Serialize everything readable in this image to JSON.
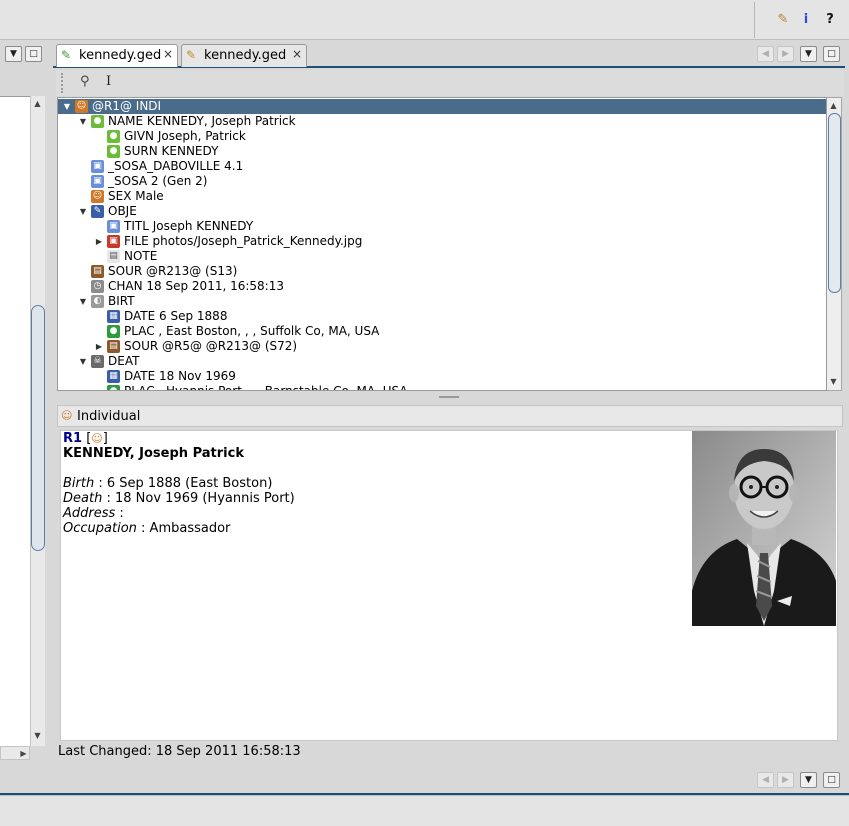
{
  "colors": {
    "accent": "#1f4e79",
    "selection": "#4b6b8a",
    "link_id": "#00008b"
  },
  "top_toolbar": {
    "icons": [
      "hint-icon",
      "info-icon",
      "context-help-icon"
    ]
  },
  "tabs": [
    {
      "label": "kennedy.ged",
      "icon": "pencil-edit-icon",
      "close": "×",
      "active": true
    },
    {
      "label": "kennedy.ged",
      "icon": "tree-view-icon",
      "close": "×",
      "active": false
    }
  ],
  "editor_toolbar": {
    "icons": [
      "link-icon",
      "text-cursor-icon"
    ],
    "cursor_glyph": "I"
  },
  "tree": {
    "rows": [
      {
        "label": "@R1@ INDI",
        "toggle": "▼",
        "icon": "person-icon",
        "selected": true
      },
      {
        "label": "NAME KENNEDY, Joseph Patrick",
        "toggle": "▼",
        "icon": "name-bubble-icon"
      },
      {
        "label": "GIVN Joseph, Patrick",
        "toggle": "",
        "icon": "name-bubble-icon"
      },
      {
        "label": "SURN KENNEDY",
        "toggle": "",
        "icon": "name-bubble-icon"
      },
      {
        "label": "_SOSA_DABOVILLE 4.1",
        "toggle": "",
        "icon": "tag-icon"
      },
      {
        "label": "_SOSA 2 (Gen 2)",
        "toggle": "",
        "icon": "tag-icon"
      },
      {
        "label": "SEX Male",
        "toggle": "",
        "icon": "person-icon"
      },
      {
        "label": "OBJE",
        "toggle": "▼",
        "icon": "media-icon"
      },
      {
        "label": "TITL Joseph KENNEDY",
        "toggle": "",
        "icon": "tag-icon"
      },
      {
        "label": "FILE photos/Joseph_Patrick_Kennedy.jpg",
        "toggle": "▶",
        "icon": "image-file-icon"
      },
      {
        "label": "NOTE",
        "toggle": "",
        "icon": "note-icon"
      },
      {
        "label": "SOUR @R213@ (S13)",
        "toggle": "",
        "icon": "source-icon"
      },
      {
        "label": "CHAN 18 Sep 2011, 16:58:13",
        "toggle": "",
        "icon": "clock-icon"
      },
      {
        "label": "BIRT",
        "toggle": "▼",
        "icon": "birth-icon"
      },
      {
        "label": "DATE 6 Sep 1888",
        "toggle": "",
        "icon": "date-icon"
      },
      {
        "label": "PLAC , East Boston, , , Suffolk Co, MA, USA",
        "toggle": "",
        "icon": "globe-icon"
      },
      {
        "label": "SOUR @R5@ @R213@ (S72)",
        "toggle": "▶",
        "icon": "source-icon"
      },
      {
        "label": "DEAT",
        "toggle": "▼",
        "icon": "death-icon"
      },
      {
        "label": "DATE 18 Nov 1969",
        "toggle": "",
        "icon": "date-icon"
      },
      {
        "label": "PLAC , Hyannis Port, , , Barnstable Co, MA, USA",
        "toggle": "",
        "icon": "globe-icon"
      }
    ]
  },
  "detail": {
    "header": "Individual",
    "id": "R1",
    "bracket_open": "[",
    "bracket_close": "]",
    "name": "KENNEDY, Joseph Patrick",
    "fields": [
      {
        "label": "Birth",
        "sep": " : ",
        "value": "6 Sep 1888  (East Boston)"
      },
      {
        "label": "Death",
        "sep": " : ",
        "value": "18 Nov 1969  (Hyannis Port)"
      },
      {
        "label": "Address",
        "sep": " :",
        "value": ""
      },
      {
        "label": "Occupation",
        "sep": " : ",
        "value": "Ambassador"
      }
    ]
  },
  "status": {
    "last_changed": "Last Changed: 18 Sep 2011 16:58:13"
  },
  "window_buttons": {
    "prev": "◀",
    "next": "▶",
    "dropdown": "▼",
    "maximize": "□"
  }
}
